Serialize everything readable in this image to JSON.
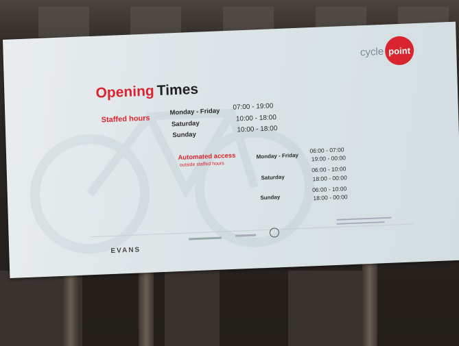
{
  "sign": {
    "logo": {
      "cycle": "cycle",
      "point": "point"
    },
    "title": {
      "opening": "Opening",
      "times": "Times"
    },
    "staffed_label": "Staffed hours",
    "staffed_rows": [
      {
        "day": "Monday - Friday",
        "time": "07:00 - 19:00"
      },
      {
        "day": "Saturday",
        "time": "10:00 - 18:00"
      },
      {
        "day": "Sunday",
        "time": "10:00 - 18:00"
      }
    ],
    "automated_label": "Automated access",
    "automated_sub": "outside staffed hours",
    "automated_rows": [
      {
        "day": "Monday - Friday",
        "times": [
          "06:00 - 07:00",
          "19:00 - 00:00"
        ]
      },
      {
        "day": "Saturday",
        "times": [
          "06:00 - 10:00",
          "18:00 - 00:00"
        ]
      },
      {
        "day": "Sunday",
        "times": [
          "06:00 - 10:00",
          "18:00 - 00:00"
        ]
      }
    ],
    "footer_brand": "EVANS"
  },
  "colors": {
    "accent": "#d9252f",
    "sign_bg": "#e4eaec"
  }
}
